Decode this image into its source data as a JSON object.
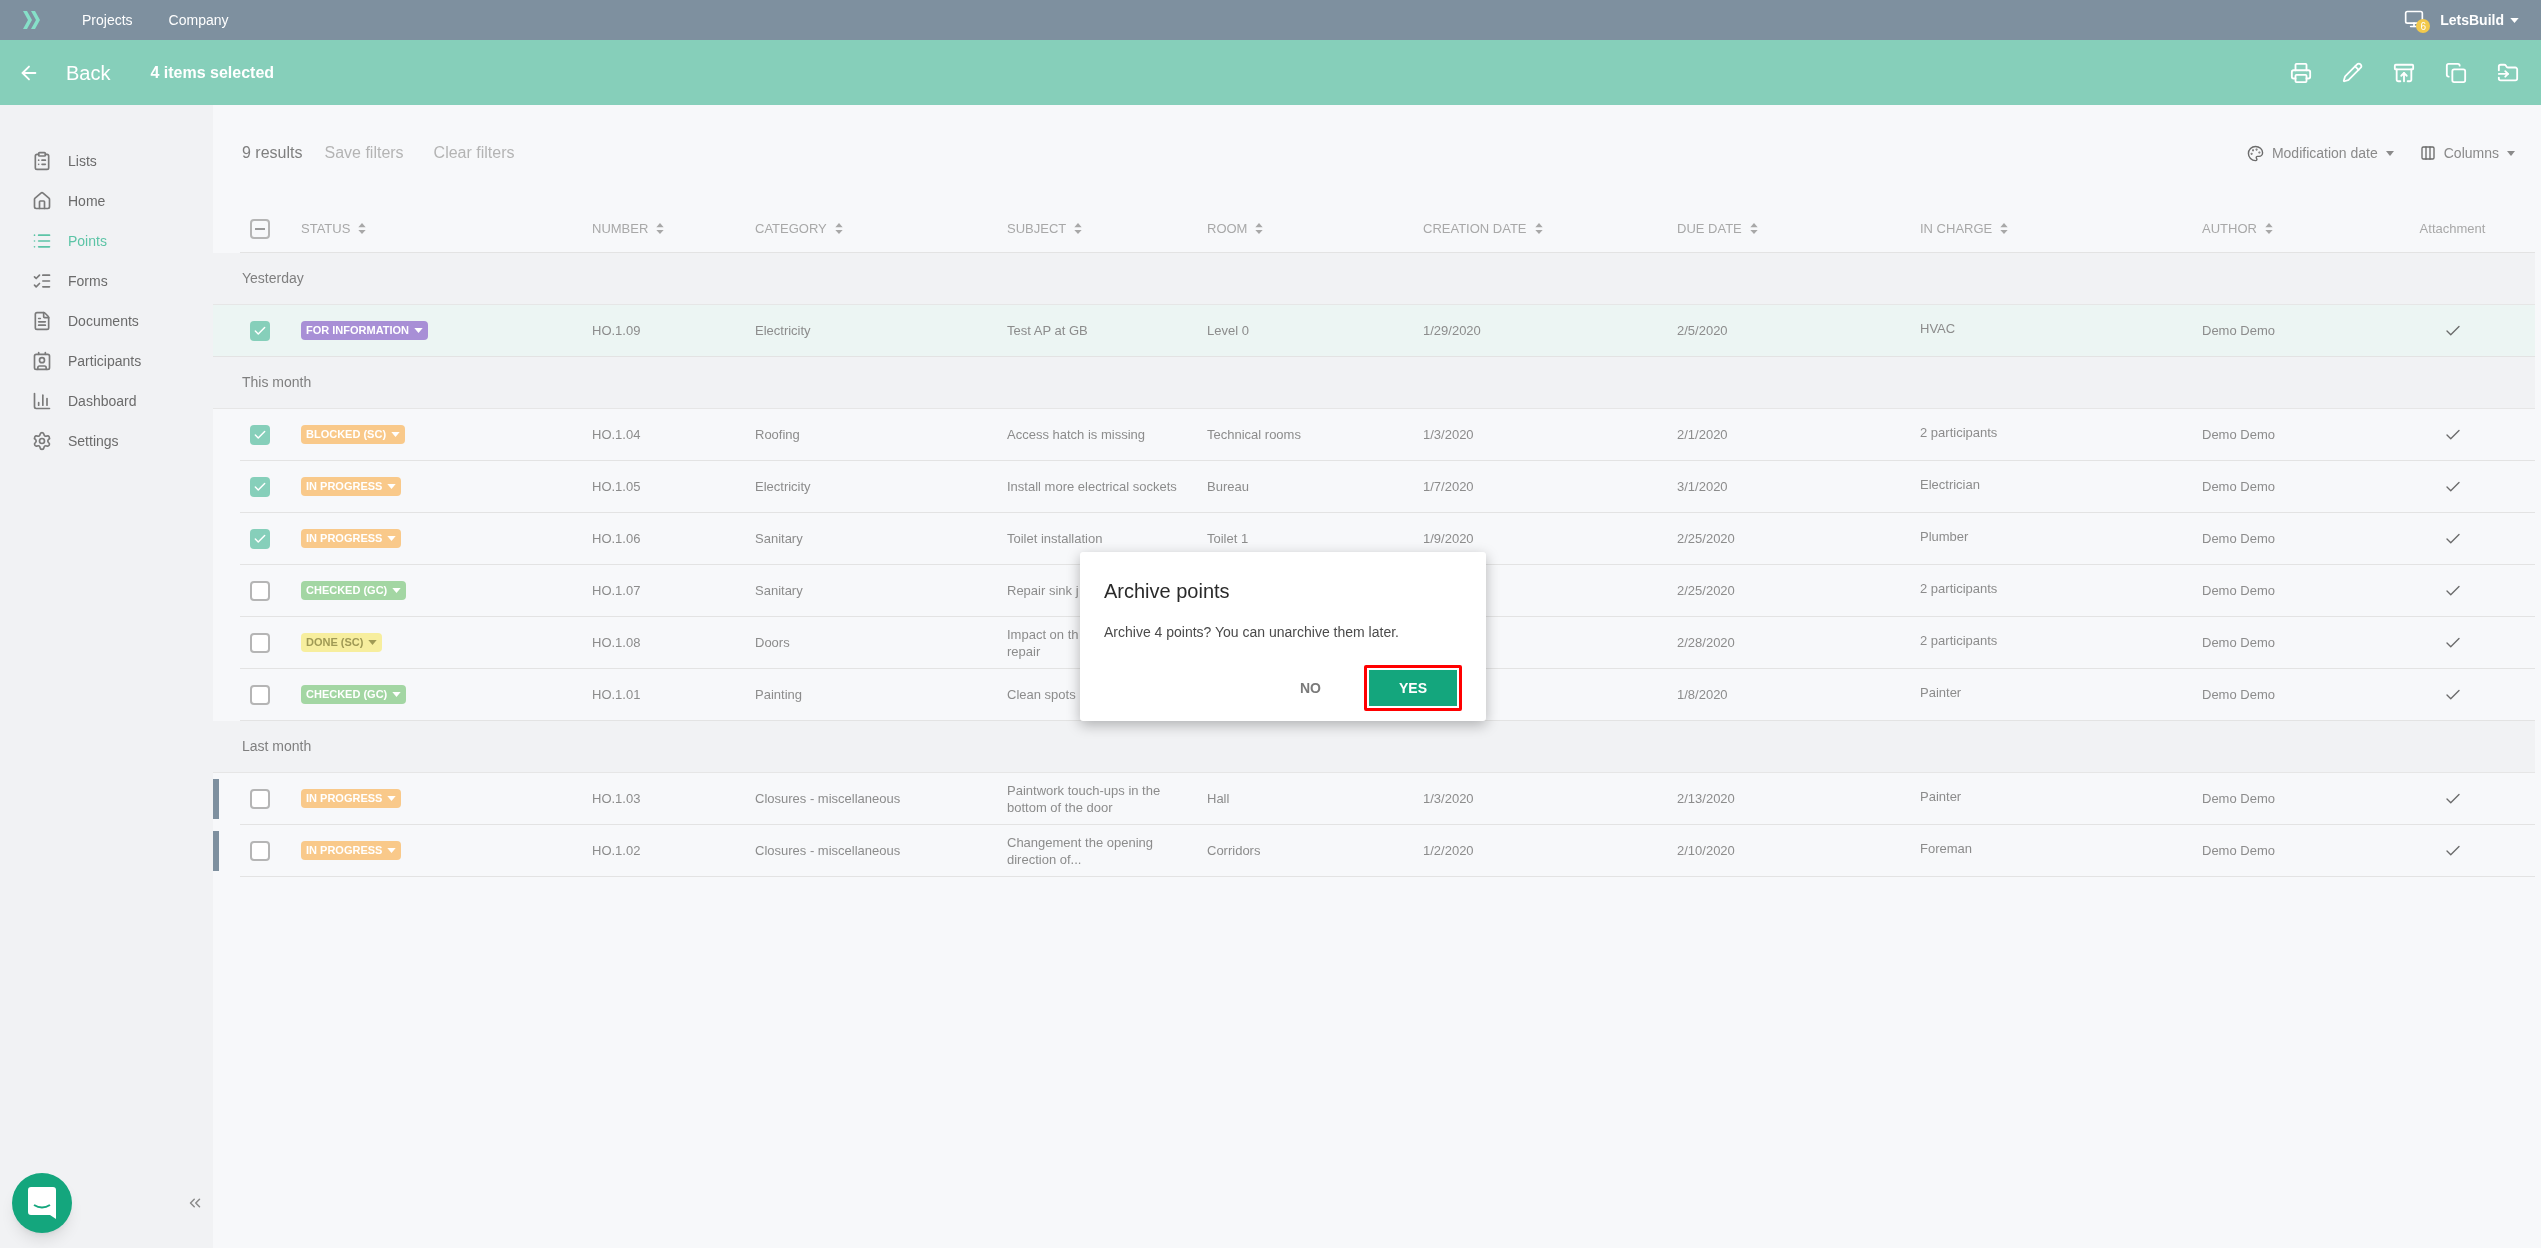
{
  "top_nav": {
    "items": [
      "Projects",
      "Company"
    ],
    "notifications": "6",
    "user": "LetsBuild"
  },
  "action_bar": {
    "back": "Back",
    "selection": "4 items selected"
  },
  "sidebar": {
    "items": [
      {
        "label": "Lists",
        "selected": false
      },
      {
        "label": "Home",
        "selected": false
      },
      {
        "label": "Points",
        "selected": true
      },
      {
        "label": "Forms",
        "selected": false
      },
      {
        "label": "Documents",
        "selected": false
      },
      {
        "label": "Participants",
        "selected": false
      },
      {
        "label": "Dashboard",
        "selected": false
      },
      {
        "label": "Settings",
        "selected": false
      }
    ]
  },
  "toolbar": {
    "results": "9 results",
    "save_filters": "Save filters",
    "clear_filters": "Clear filters",
    "sort": "Modification date",
    "columns": "Columns"
  },
  "table": {
    "select_all_indeterminate": true,
    "columns": [
      {
        "label": "STATUS",
        "sortable": true
      },
      {
        "label": "NUMBER",
        "sortable": true
      },
      {
        "label": "CATEGORY",
        "sortable": true
      },
      {
        "label": "SUBJECT",
        "sortable": true
      },
      {
        "label": "ROOM",
        "sortable": true
      },
      {
        "label": "CREATION DATE",
        "sortable": true
      },
      {
        "label": "DUE DATE",
        "sortable": true
      },
      {
        "label": "IN CHARGE",
        "sortable": true
      },
      {
        "label": "AUTHOR",
        "sortable": true
      },
      {
        "label": "Attachment",
        "sortable": false
      }
    ],
    "groups": [
      {
        "label": "Yesterday",
        "rows": [
          {
            "checked": true,
            "highlighted": true,
            "marked": false,
            "status": {
              "label": "FOR INFORMATION",
              "color": "#a88fd6"
            },
            "number": "HO.1.09",
            "category": "Electricity",
            "subject": "Test AP at GB",
            "room": "Level 0",
            "creation_date": "1/29/2020",
            "due_date": "2/5/2020",
            "in_charge": "HVAC",
            "author": "Demo Demo",
            "attachment": true
          }
        ]
      },
      {
        "label": "This month",
        "rows": [
          {
            "checked": true,
            "highlighted": false,
            "marked": false,
            "status": {
              "label": "BLOCKED (SC)",
              "color": "#f9c98a"
            },
            "number": "HO.1.04",
            "category": "Roofing",
            "subject": "Access hatch is missing",
            "room": "Technical rooms",
            "creation_date": "1/3/2020",
            "due_date": "2/1/2020",
            "in_charge": "2 participants",
            "author": "Demo Demo",
            "attachment": true
          },
          {
            "checked": true,
            "highlighted": false,
            "marked": false,
            "status": {
              "label": "IN PROGRESS",
              "color": "#f9c98a"
            },
            "number": "HO.1.05",
            "category": "Electricity",
            "subject": "Install more electrical sockets",
            "room": "Bureau",
            "creation_date": "1/7/2020",
            "due_date": "3/1/2020",
            "in_charge": "Electrician",
            "author": "Demo Demo",
            "attachment": true
          },
          {
            "checked": true,
            "highlighted": false,
            "marked": false,
            "status": {
              "label": "IN PROGRESS",
              "color": "#f9c98a"
            },
            "number": "HO.1.06",
            "category": "Sanitary",
            "subject": "Toilet installation",
            "room": "Toilet 1",
            "creation_date": "1/9/2020",
            "due_date": "2/25/2020",
            "in_charge": "Plumber",
            "author": "Demo Demo",
            "attachment": true
          },
          {
            "checked": false,
            "highlighted": false,
            "marked": false,
            "status": {
              "label": "CHECKED (GC)",
              "color": "#a3d6a3"
            },
            "number": "HO.1.07",
            "category": "Sanitary",
            "subject": "Repair sink j",
            "due_date": "2/25/2020",
            "in_charge": "2 participants",
            "author": "Demo Demo",
            "attachment": true
          },
          {
            "checked": false,
            "highlighted": false,
            "marked": false,
            "status": {
              "label": "DONE (SC)",
              "color": "#f7ee9e"
            },
            "number": "HO.1.08",
            "category": "Doors",
            "subject": "Impact on th\nrepair",
            "due_date": "2/28/2020",
            "in_charge": "2 participants",
            "author": "Demo Demo",
            "attachment": true
          },
          {
            "checked": false,
            "highlighted": false,
            "marked": false,
            "status": {
              "label": "CHECKED (GC)",
              "color": "#a3d6a3"
            },
            "number": "HO.1.01",
            "category": "Painting",
            "subject": "Clean spots",
            "due_date": "1/8/2020",
            "in_charge": "Painter",
            "author": "Demo Demo",
            "attachment": true
          }
        ]
      },
      {
        "label": "Last month",
        "rows": [
          {
            "checked": false,
            "highlighted": false,
            "marked": true,
            "status": {
              "label": "IN PROGRESS",
              "color": "#f9c98a"
            },
            "number": "HO.1.03",
            "category": "Closures - miscellaneous",
            "subject": "Paintwork touch-ups in the bottom of the door",
            "room": "Hall",
            "creation_date": "1/3/2020",
            "due_date": "2/13/2020",
            "in_charge": "Painter",
            "author": "Demo Demo",
            "attachment": true
          },
          {
            "checked": false,
            "highlighted": false,
            "marked": true,
            "status": {
              "label": "IN PROGRESS",
              "color": "#f9c98a"
            },
            "number": "HO.1.02",
            "category": "Closures - miscellaneous",
            "subject": "Changement the opening direction of...",
            "room": "Corridors",
            "creation_date": "1/2/2020",
            "due_date": "2/10/2020",
            "in_charge": "Foreman",
            "author": "Demo Demo",
            "attachment": true
          }
        ]
      }
    ]
  },
  "dialog": {
    "title": "Archive points",
    "message": "Archive 4 points? You can unarchive them later.",
    "buttons": [
      {
        "label": "NO",
        "kind": "text",
        "highlighted": false
      },
      {
        "label": "YES",
        "kind": "primary",
        "highlighted": true
      }
    ]
  }
}
